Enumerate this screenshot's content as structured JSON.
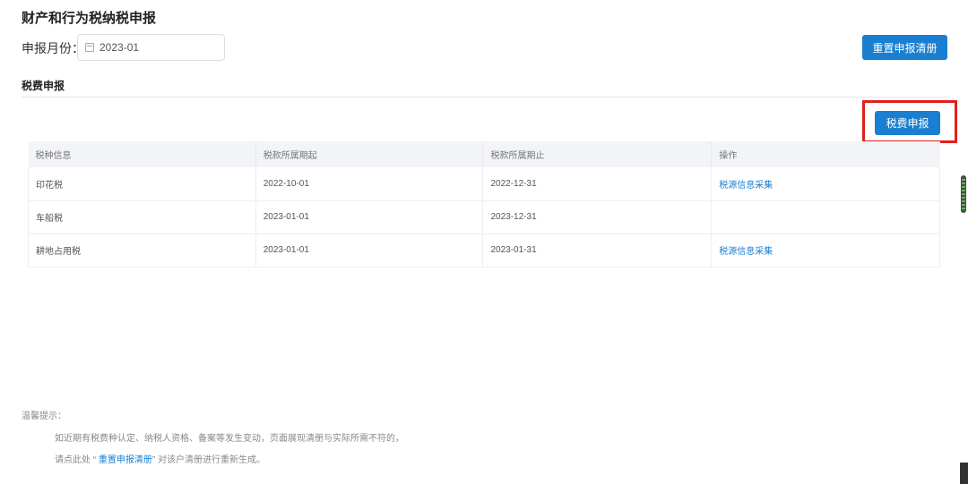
{
  "page": {
    "title": "财产和行为税纳税申报"
  },
  "filter": {
    "label": "申报月份：",
    "month_value": "2023-01"
  },
  "toolbar": {
    "reset_label": "重置申报清册"
  },
  "section": {
    "title": "税费申报",
    "declare_label": "税费申报"
  },
  "table": {
    "headers": [
      "税种信息",
      "税款所属期起",
      "税款所属期止",
      "操作"
    ],
    "rows": [
      {
        "tax": "印花税",
        "start": "2022-10-01",
        "end": "2022-12-31",
        "action": "税源信息采集"
      },
      {
        "tax": "车船税",
        "start": "2023-01-01",
        "end": "2023-12-31",
        "action": ""
      },
      {
        "tax": "耕地占用税",
        "start": "2023-01-01",
        "end": "2023-01-31",
        "action": "税源信息采集"
      }
    ]
  },
  "tips": {
    "title": "温馨提示：",
    "line1": "如近期有税费种认定、纳税人资格、备案等发生变动，页面展现清册与实际所需不符的，",
    "line2_prefix": "请点此处 “ ",
    "line2_link": "重置申报清册",
    "line2_suffix": "” 对该户清册进行重新生成。"
  },
  "colors": {
    "primary": "#1a7fd0",
    "highlight": "#e0201c"
  }
}
